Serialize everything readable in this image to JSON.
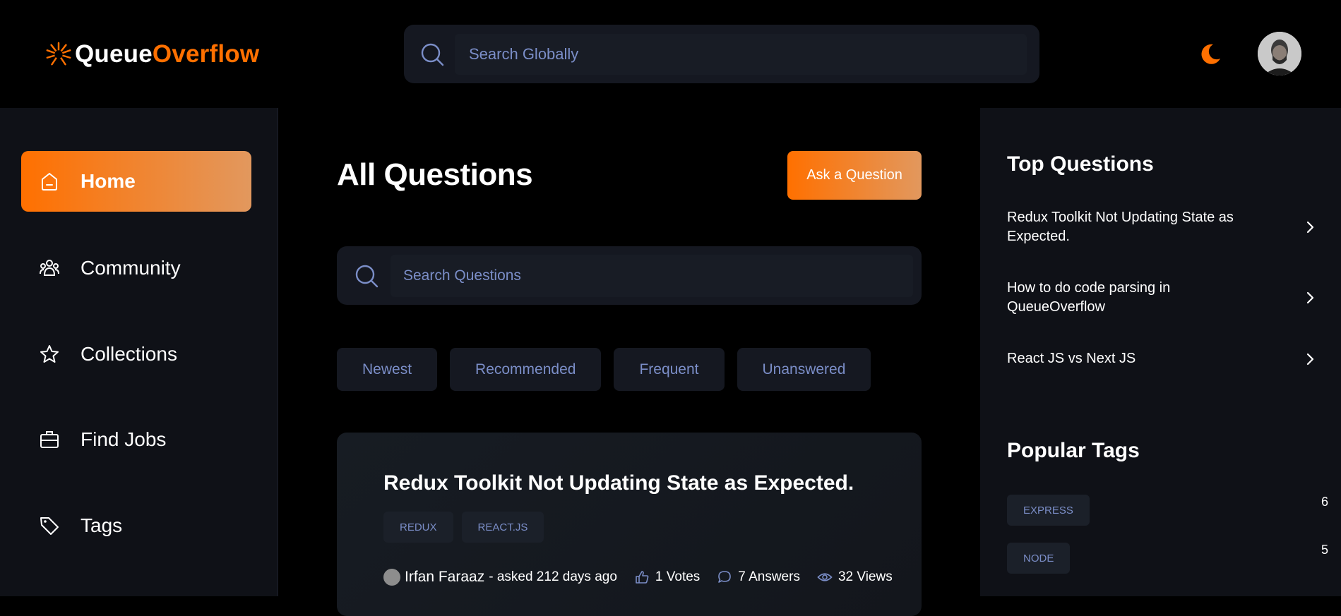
{
  "brand": {
    "name_part1": "Queue",
    "name_part2": "Overflow",
    "accent": "#ff7000"
  },
  "header": {
    "search": {
      "placeholder": "Search Globally",
      "icon": "search-icon"
    },
    "theme_icon": "moon-icon",
    "avatar_icon": "user-avatar"
  },
  "sidebar": {
    "items": [
      {
        "label": "Home",
        "icon": "home-icon",
        "active": true
      },
      {
        "label": "Community",
        "icon": "users-icon",
        "active": false
      },
      {
        "label": "Collections",
        "icon": "star-icon",
        "active": false
      },
      {
        "label": "Find Jobs",
        "icon": "briefcase-icon",
        "active": false
      },
      {
        "label": "Tags",
        "icon": "tag-icon",
        "active": false
      }
    ]
  },
  "main": {
    "title": "All Questions",
    "ask_button": "Ask a Question",
    "search": {
      "placeholder": "Search Questions"
    },
    "filters": [
      "Newest",
      "Recommended",
      "Frequent",
      "Unanswered"
    ],
    "questions": [
      {
        "title": "Redux Toolkit Not Updating State as Expected.",
        "tags": [
          "REDUX",
          "REACT.JS"
        ],
        "author": "Irfan Faraaz",
        "asked": "- asked 212 days ago",
        "votes": "1 Votes",
        "answers": "7 Answers",
        "views": "32 Views"
      }
    ]
  },
  "right_sidebar": {
    "top_questions_heading": "Top Questions",
    "top_questions": [
      "Redux Toolkit Not Updating State as Expected.",
      "How to do code parsing in QueueOverflow",
      "React JS vs Next JS"
    ],
    "popular_tags_heading": "Popular Tags",
    "popular_tags": [
      {
        "name": "EXPRESS",
        "count": "6"
      },
      {
        "name": "NODE",
        "count": "5"
      }
    ]
  }
}
